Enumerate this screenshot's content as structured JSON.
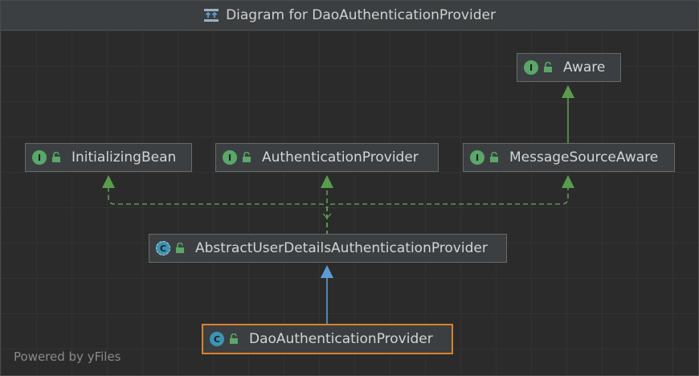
{
  "window": {
    "title": "Diagram for DaoAuthenticationProvider"
  },
  "nodes": {
    "aware": {
      "label": "Aware",
      "kind": "interface",
      "badge": "I"
    },
    "initializing_bean": {
      "label": "InitializingBean",
      "kind": "interface",
      "badge": "I"
    },
    "authentication_provider": {
      "label": "AuthenticationProvider",
      "kind": "interface",
      "badge": "I"
    },
    "message_source_aware": {
      "label": "MessageSourceAware",
      "kind": "interface",
      "badge": "I"
    },
    "abstract_provider": {
      "label": "AbstractUserDetailsAuthenticationProvider",
      "kind": "abstract-class",
      "badge": "C"
    },
    "dao_provider": {
      "label": "DaoAuthenticationProvider",
      "kind": "class",
      "badge": "C",
      "selected": true
    }
  },
  "footer": {
    "text": "Powered by yFiles"
  },
  "colors": {
    "interface_badge": "#59a869",
    "class_badge": "#3a95b5",
    "implements_edge": "#5a9c4d",
    "extends_edge": "#5b9bd5",
    "selection": "#d9822b"
  }
}
